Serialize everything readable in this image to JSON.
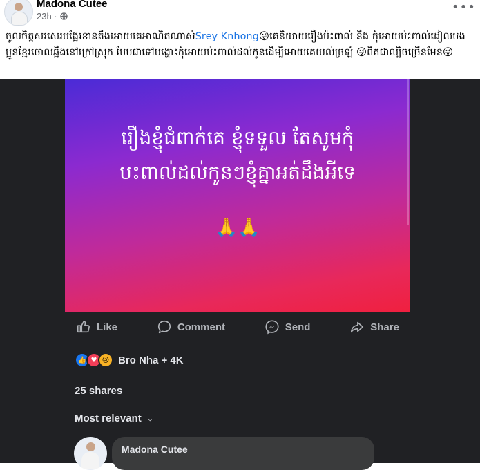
{
  "post": {
    "author": "Madona Cutee",
    "time": "23h ·",
    "privacy_icon": "globe-icon",
    "more_icon": "more-dots-icon",
    "more_label": "•••",
    "caption_part1": "ចូលចិត្តសរសេរបង្អែរខានតីងអោយគេអាណិតណាស់",
    "caption_mention": "Srey Knhong",
    "caption_emoji1": "😜",
    "caption_part2": "គេនិយាយរឿងប៉ះពាល់ នឹង កុំអោយប៉ះពាល់ដៀលបងប្អូនខ្មែរចោលឆ្អឹងនៅក្រៅស្រុក បែបជាទៅបង្ហោះកុំអោយប៉ះពាល់ដល់កូនដើម្បីអោយគេយល់ច្រឡំ",
    "caption_emoji2": "😜",
    "caption_part3": "ពិតជាល្បិចច្រើនមែន",
    "caption_emoji3": "😜"
  },
  "image": {
    "line1": "រឿងខ្ញុំជំពាក់គេ ខ្ញុំទទួល តែសូមកុំ",
    "line2": "បះពាល់ដល់កូនៗខ្ញុំគ្នាអត់ដឹងអីទេ",
    "emoji": "🙏🙏"
  },
  "actions": {
    "like": "Like",
    "comment": "Comment",
    "send": "Send",
    "share": "Share"
  },
  "reactions": {
    "icons": [
      "like-icon",
      "love-icon",
      "sad-icon"
    ],
    "summary": "Bro Nha + 4K"
  },
  "shares": "25 shares",
  "sort_label": "Most relevant",
  "comment": {
    "author": "Madona Cutee"
  },
  "colors": {
    "link": "#1b74e4",
    "dark_bg": "#202124",
    "like_blue": "#1877f2",
    "love_red": "#f33e58",
    "sad_yellow": "#f7b125"
  }
}
